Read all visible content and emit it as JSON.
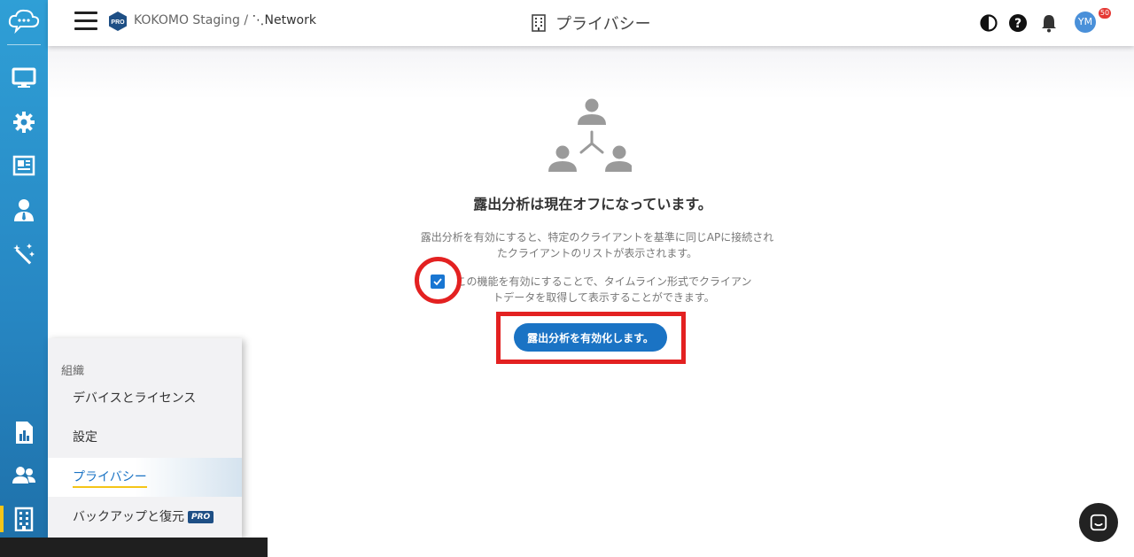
{
  "header": {
    "breadcrumb_org": "KOKOMO Staging /",
    "breadcrumb_network": "Network",
    "pro_label": "PRO",
    "page_title": "プライバシー",
    "notification_count": "50",
    "avatar_initials": "YM"
  },
  "main": {
    "heading": "露出分析は現在オフになっています。",
    "description_1": "露出分析を有効にすると、特定のクライアントを基準に同じAPに接続されたクライアントのリストが表示されます。",
    "description_2": "この機能を有効にすることで、タイムライン形式でクライアントデータを取得して表示することができます。",
    "checkbox_checked": true,
    "enable_button": "露出分析を有効化します。"
  },
  "submenu": {
    "group_label": "組織",
    "items": [
      {
        "label": "デバイスとライセンス"
      },
      {
        "label": "設定"
      },
      {
        "label": "プライバシー",
        "active": true
      },
      {
        "label": "バックアップと復元",
        "badge": "PRO"
      }
    ]
  },
  "rail": {
    "icons": [
      "monitor-icon",
      "gear-icon",
      "newspaper-icon",
      "person-tie-icon",
      "magic-wand-icon",
      "report-chart-icon",
      "users-icon",
      "building-icon"
    ]
  },
  "colors": {
    "accent": "#1a73c4",
    "annotation": "#e32121",
    "active_underline": "#f5c518"
  }
}
